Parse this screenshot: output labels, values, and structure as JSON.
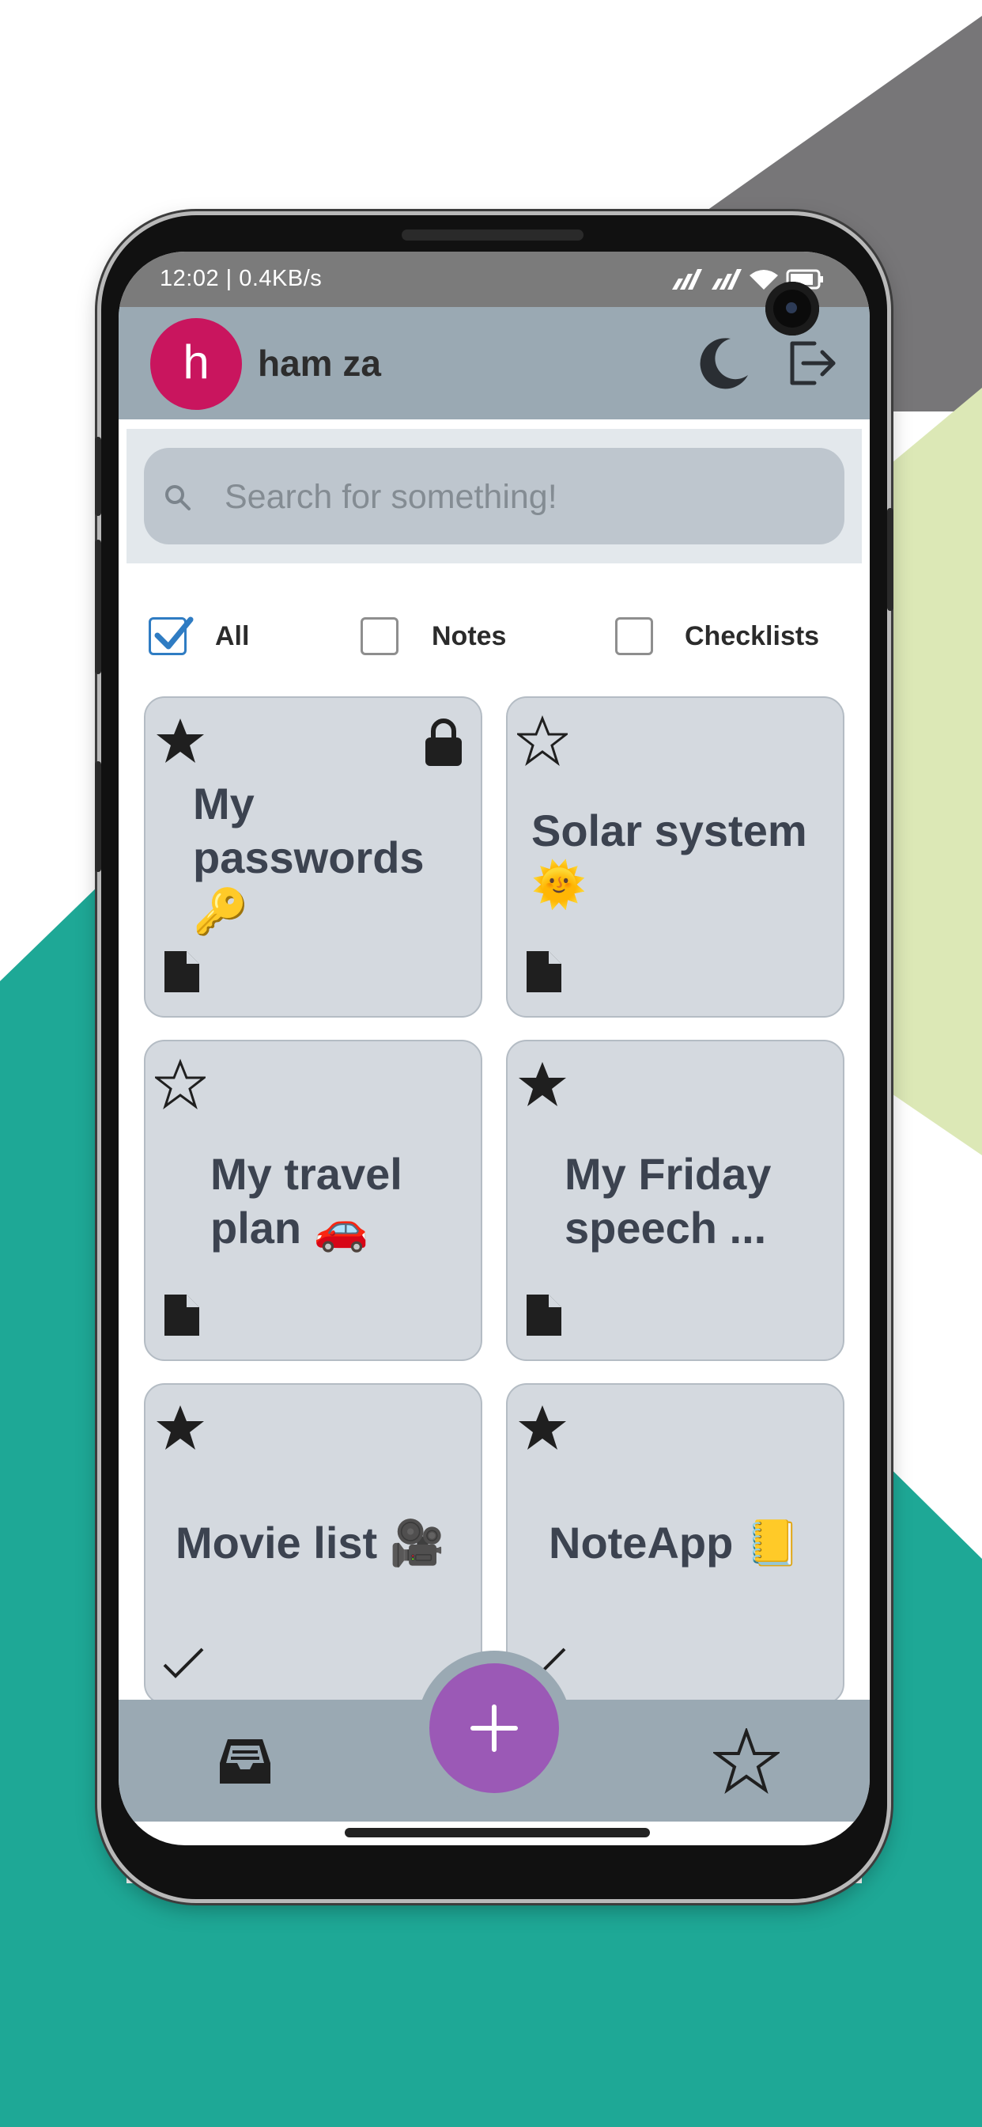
{
  "status_bar": {
    "text": "12:02 | 0.4KB/s",
    "icons": [
      "signal-icon",
      "signal-icon",
      "wifi-icon",
      "battery-icon"
    ]
  },
  "header": {
    "avatar_letter": "h",
    "user_name": "ham za",
    "avatar_color": "#c9155e",
    "actions": [
      "dark-mode-moon-icon",
      "logout-icon"
    ]
  },
  "search": {
    "placeholder": "Search for something!",
    "value": ""
  },
  "filters": [
    {
      "label": "All",
      "checked": true
    },
    {
      "label": "Notes",
      "checked": false
    },
    {
      "label": "Checklists",
      "checked": false
    }
  ],
  "notes": [
    {
      "title": "My passwords 🔑",
      "starred": true,
      "locked": true,
      "type": "note"
    },
    {
      "title": "Solar system 🌞",
      "starred": false,
      "locked": false,
      "type": "note"
    },
    {
      "title": "My travel plan 🚗",
      "starred": false,
      "locked": false,
      "type": "note"
    },
    {
      "title": "My Friday speech ...",
      "starred": true,
      "locked": false,
      "type": "note"
    },
    {
      "title": "Movie list 🎥",
      "starred": true,
      "locked": false,
      "type": "checklist"
    },
    {
      "title": "NoteApp 📒",
      "starred": true,
      "locked": false,
      "type": "checklist"
    }
  ],
  "bottom_nav": {
    "items": [
      "inbox-icon",
      "add-icon",
      "star-icon"
    ],
    "fab_label": "+",
    "fab_color": "#9b59b6"
  },
  "colors": {
    "teal": "#1ea896",
    "gray": "#777678",
    "lime": "#dce8b6",
    "header": "#9aa9b3",
    "card": "#d4d9df"
  }
}
